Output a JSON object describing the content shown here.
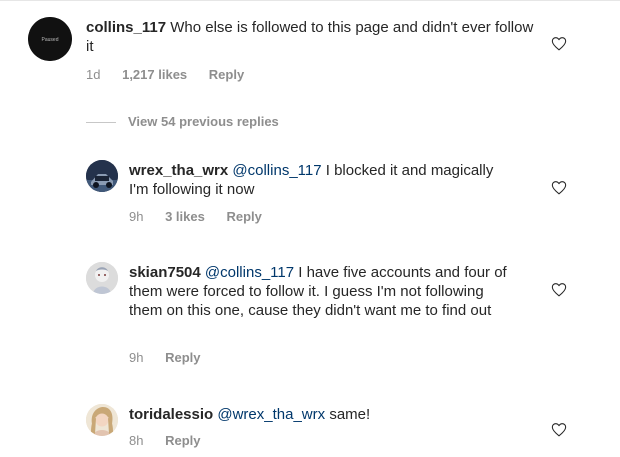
{
  "comments": [
    {
      "username": "collins_117",
      "mention": "",
      "text": "Who else is followed to this page and didn't ever follow it",
      "time": "1d",
      "likes": "1,217 likes",
      "reply": "Reply",
      "avatar_text": "Paused"
    },
    {
      "username": "wrex_tha_wrx",
      "mention": "@collins_117",
      "text": "I blocked it and magically I'm following it now",
      "time": "9h",
      "likes": "3 likes",
      "reply": "Reply"
    },
    {
      "username": "skian7504",
      "mention": "@collins_117",
      "text": "I have five accounts and four of them were forced to follow it. I guess I'm not following them on this one, cause they didn't want me to find out",
      "time": "9h",
      "reply": "Reply"
    },
    {
      "username": "toridalessio",
      "mention": "@wrex_tha_wrx",
      "text": "same!",
      "time": "8h",
      "reply": "Reply"
    }
  ],
  "view_replies": "View 54 previous replies",
  "icons": {
    "like": "heart-outline-icon"
  },
  "colors": {
    "text": "#262626",
    "muted": "#8e8e8e",
    "mention": "#00376b"
  }
}
